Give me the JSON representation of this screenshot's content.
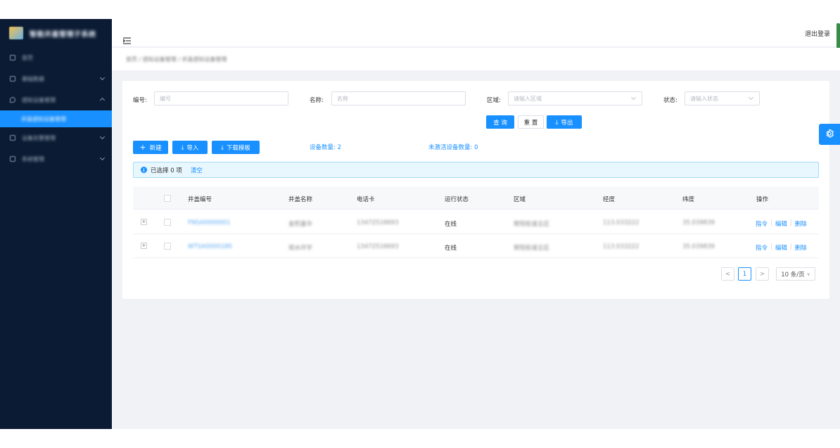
{
  "sidebar": {
    "logo_text": "智能井盖管理子系统",
    "items": [
      {
        "label": "首页"
      },
      {
        "label": "基础数据"
      },
      {
        "label": "感知设备管理"
      },
      {
        "label": "设备告警管理"
      },
      {
        "label": "系统管理"
      }
    ],
    "sub_item": "井盖感知设备管理"
  },
  "header": {
    "logout": "退出登录"
  },
  "breadcrumb": "首页 / 感知设备管理 / 井盖感知设备管理",
  "filters": {
    "code_label": "编号:",
    "code_placeholder": "编号",
    "name_label": "名称:",
    "name_placeholder": "名称",
    "area_label": "区域:",
    "area_placeholder": "请输入区域",
    "status_label": "状态:",
    "status_placeholder": "请输入状态"
  },
  "actions": {
    "query": "查 询",
    "reset": "重 置",
    "export": "导出",
    "add": "新建",
    "import": "导入",
    "download_template": "下载模板"
  },
  "stats": {
    "device_count": "设备数量: 2",
    "inactive_count": "未激活设备数量: 0"
  },
  "selection": {
    "text": "已选择 0 项",
    "clear": "清空"
  },
  "table": {
    "columns": [
      "井盖编号",
      "井盖名称",
      "电话卡",
      "运行状态",
      "区域",
      "经度",
      "纬度",
      "操作"
    ],
    "rows": [
      {
        "code": "FNSA0000001",
        "name": "金熙嘉华",
        "sim": "13472516693",
        "status": "在线",
        "area": "樊阳街道五区",
        "lng": "113.033222",
        "lat": "35.039839"
      },
      {
        "code": "WTSA0000180",
        "name": "观水环宇",
        "sim": "13472516693",
        "status": "在线",
        "area": "樊阳街道五区",
        "lng": "113.033222",
        "lat": "35.039839"
      }
    ],
    "ops": {
      "command": "指令",
      "edit": "编辑",
      "delete": "删除"
    }
  },
  "pagination": {
    "prev": "<",
    "current": "1",
    "next": ">",
    "page_size": "10 条/页"
  },
  "colors": {
    "primary": "#1890ff",
    "sidebar_bg": "#0b1b33",
    "page_bg": "#f0f2f5"
  }
}
